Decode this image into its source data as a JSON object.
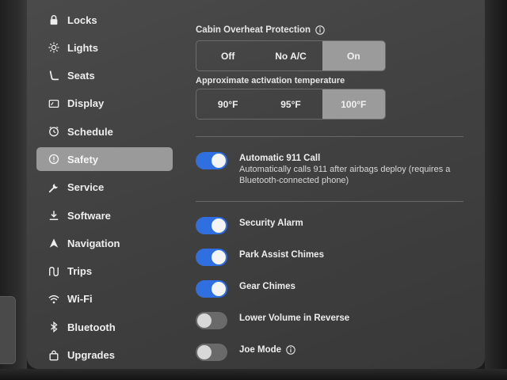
{
  "sidebar": {
    "items": [
      {
        "label": "Locks",
        "icon": "lock-icon"
      },
      {
        "label": "Lights",
        "icon": "sun-icon"
      },
      {
        "label": "Seats",
        "icon": "seat-icon"
      },
      {
        "label": "Display",
        "icon": "display-icon"
      },
      {
        "label": "Schedule",
        "icon": "clock-icon"
      },
      {
        "label": "Safety",
        "icon": "alert-circle-icon"
      },
      {
        "label": "Service",
        "icon": "wrench-icon"
      },
      {
        "label": "Software",
        "icon": "download-icon"
      },
      {
        "label": "Navigation",
        "icon": "navigation-arrow-icon"
      },
      {
        "label": "Trips",
        "icon": "trips-icon"
      },
      {
        "label": "Wi-Fi",
        "icon": "wifi-icon"
      },
      {
        "label": "Bluetooth",
        "icon": "bluetooth-icon"
      },
      {
        "label": "Upgrades",
        "icon": "shopping-bag-icon"
      }
    ],
    "active": "Safety"
  },
  "cabin_overheat": {
    "label": "Cabin Overheat Protection",
    "options": [
      "Off",
      "No A/C",
      "On"
    ],
    "selected": "On"
  },
  "activation_temp": {
    "label": "Approximate activation temperature",
    "options": [
      "90°F",
      "95°F",
      "100°F"
    ],
    "selected": "100°F"
  },
  "toggles": [
    {
      "title": "Automatic 911 Call",
      "description": "Automatically calls 911 after airbags deploy (requires a Bluetooth-connected phone)",
      "on": true
    },
    {
      "title": "Security Alarm",
      "on": true
    },
    {
      "title": "Park Assist Chimes",
      "on": true
    },
    {
      "title": "Gear Chimes",
      "on": true
    },
    {
      "title": "Lower Volume in Reverse",
      "on": false
    },
    {
      "title": "Joe Mode",
      "on": false
    }
  ],
  "colors": {
    "toggle_on": "#2f6fe0",
    "toggle_off": "#6a6a6a",
    "selected_segment": "#9b9b9b",
    "active_nav": "#9a9a9a"
  }
}
